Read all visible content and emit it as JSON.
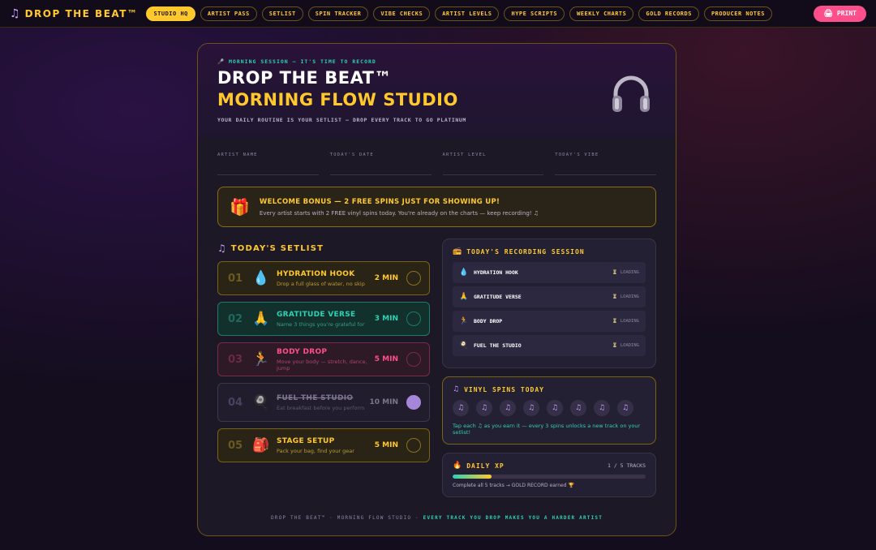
{
  "nav": {
    "brand": "DROP THE BEAT™",
    "tabs": [
      "STUDIO HQ",
      "ARTIST PASS",
      "SETLIST",
      "SPIN TRACKER",
      "VIBE CHECKS",
      "ARTIST LEVELS",
      "HYPE SCRIPTS",
      "WEEKLY CHARTS",
      "GOLD RECORDS",
      "PRODUCER NOTES"
    ],
    "active_tab": "STUDIO HQ",
    "print_label": "PRINT"
  },
  "hero": {
    "eyebrow": "MORNING SESSION — IT'S TIME TO RECORD",
    "title_line1": "DROP THE BEAT™",
    "title_line2": "MORNING FLOW STUDIO",
    "tagline": "YOUR DAILY ROUTINE IS YOUR SETLIST — DROP EVERY TRACK TO GO PLATINUM"
  },
  "fields": [
    "ARTIST NAME",
    "TODAY'S DATE",
    "ARTIST LEVEL",
    "TODAY'S VIBE"
  ],
  "bonus": {
    "title": "WELCOME BONUS — 2 FREE SPINS JUST FOR SHOWING UP!",
    "sub": "Every artist starts with 2 FREE vinyl spins today. You're already on the charts — keep recording! ♫"
  },
  "setlist": {
    "title": "TODAY'S SETLIST",
    "tracks": [
      {
        "num": "01",
        "emoji": "💧",
        "name": "HYDRATION HOOK",
        "desc": "Drop a full glass of water, no skip",
        "dur": "2 MIN",
        "done": false,
        "theme": "yellow"
      },
      {
        "num": "02",
        "emoji": "🙏",
        "name": "GRATITUDE VERSE",
        "desc": "Name 3 things you're grateful for",
        "dur": "3 MIN",
        "done": false,
        "theme": "teal"
      },
      {
        "num": "03",
        "emoji": "🏃",
        "name": "BODY DROP",
        "desc": "Move your body — stretch, dance, jump",
        "dur": "5 MIN",
        "done": false,
        "theme": "pink"
      },
      {
        "num": "04",
        "emoji": "🍳",
        "name": "FUEL THE STUDIO",
        "desc": "Eat breakfast before you perform",
        "dur": "10 MIN",
        "done": true,
        "theme": "done"
      },
      {
        "num": "05",
        "emoji": "🎒",
        "name": "STAGE SETUP",
        "desc": "Pack your bag, find your gear",
        "dur": "5 MIN",
        "done": false,
        "theme": "yellow"
      }
    ]
  },
  "session": {
    "title": "TODAY'S RECORDING SESSION",
    "items": [
      {
        "icon": "💧",
        "name": "HYDRATION HOOK",
        "status": "⏳ LOADING"
      },
      {
        "icon": "🙏",
        "name": "GRATITUDE VERSE",
        "status": "⏳ LOADING"
      },
      {
        "icon": "🏃",
        "name": "BODY DROP",
        "status": "⏳ LOADING"
      },
      {
        "icon": "🍳",
        "name": "FUEL THE STUDIO",
        "status": "⏳ LOADING"
      }
    ]
  },
  "spins": {
    "title": "VINYL SPINS TODAY",
    "count": 8,
    "note": "Tap each ♫ as you earn it — every 3 spins unlocks a new track on your setlist!"
  },
  "xp": {
    "title": "DAILY XP",
    "count": "1 / 5 TRACKS",
    "progress": 0.2,
    "note": "Complete all 5 tracks → GOLD RECORD earned 🏆"
  },
  "footer": {
    "part1": "DROP THE BEAT™ · MORNING FLOW STUDIO ·",
    "part2": "EVERY TRACK YOU DROP MAKES YOU A HARDER ARTIST"
  },
  "colors": {
    "gold": "#ffc92e",
    "teal": "#2ed1b4",
    "pink": "#ff4f8b",
    "purple": "#a686d8"
  }
}
